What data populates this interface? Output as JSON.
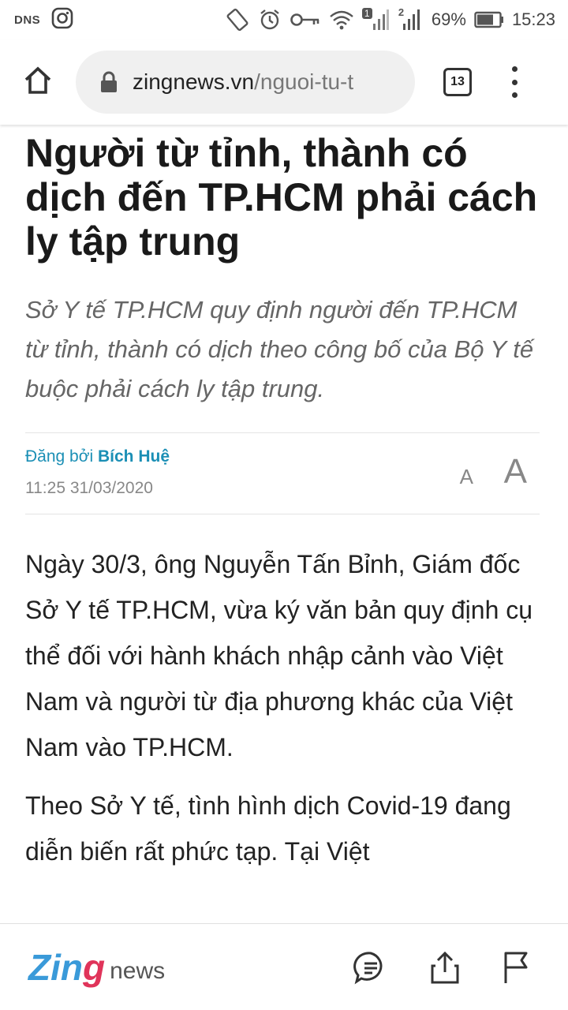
{
  "status_bar": {
    "dns_label": "DNS",
    "sim1_label": "1",
    "sim2_label": "2",
    "battery_percent": "69%",
    "time": "15:23"
  },
  "browser": {
    "url_domain": "zingnews.vn",
    "url_path": "/nguoi-tu-t",
    "tab_count": "13"
  },
  "article": {
    "title": "Người từ tỉnh, thành có dịch đến TP.HCM phải cách ly tập trung",
    "sapo": "Sở Y tế TP.HCM quy định người đến TP.HCM từ tỉnh, thành có dịch theo công bố của Bộ Y tế buộc phải cách ly tập trung.",
    "posted_by_label": "Đăng bởi",
    "author": "Bích Huệ",
    "datetime": "11:25 31/03/2020",
    "font_small_label": "A",
    "font_large_label": "A",
    "paragraphs": [
      "Ngày 30/3, ông Nguyễn Tấn Bỉnh, Giám đốc Sở Y tế TP.HCM, vừa ký văn bản quy định cụ thể đối với hành khách nhập cảnh vào Việt Nam và người từ địa phương khác của Việt Nam vào TP.HCM.",
      "Theo Sở Y tế, tình hình dịch Covid-19 đang diễn biến rất phức tạp. Tại Việt"
    ]
  },
  "bottom_bar": {
    "logo_zing_part1": "Zin",
    "logo_zing_part2": "g",
    "logo_news": "news"
  }
}
